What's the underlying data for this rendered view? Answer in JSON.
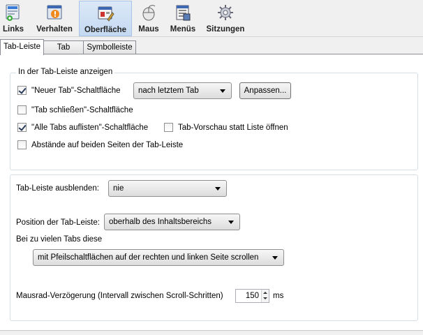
{
  "toolbar": {
    "items": [
      {
        "label": "Links",
        "icon": "links-icon"
      },
      {
        "label": "Verhalten",
        "icon": "behavior-icon"
      },
      {
        "label": "Oberfläche",
        "icon": "interface-icon",
        "selected": true
      },
      {
        "label": "Maus",
        "icon": "mouse-icon"
      },
      {
        "label": "Menüs",
        "icon": "menus-icon"
      },
      {
        "label": "Sitzungen",
        "icon": "sessions-icon"
      }
    ]
  },
  "tabs": [
    "Tab-Leiste",
    "Tab",
    "Symbolleiste"
  ],
  "active_tab": "Tab-Leiste",
  "group1": {
    "legend": "In der Tab-Leiste anzeigen",
    "new_tab_button": {
      "label": "\"Neuer Tab\"-Schaltfläche",
      "checked": true
    },
    "new_tab_combo": "nach letztem Tab",
    "customize_button": "Anpassen...",
    "close_tab_button": {
      "label": "\"Tab schließen\"-Schaltfläche",
      "checked": false
    },
    "list_all_tabs": {
      "label": "\"Alle Tabs auflisten\"-Schaltfläche",
      "checked": true
    },
    "tab_preview": {
      "label": "Tab-Vorschau statt Liste öffnen",
      "checked": false
    },
    "spacing": {
      "label": "Abstände auf beiden Seiten der Tab-Leiste",
      "checked": false
    }
  },
  "group2": {
    "hide_label": "Tab-Leiste ausblenden:",
    "hide_value": "nie",
    "position_label": "Position der Tab-Leiste:",
    "position_value": "oberhalb des Inhaltsbereichs",
    "overflow_label": "Bei zu vielen Tabs diese",
    "overflow_value": "mit Pfeilschaltflächen auf der rechten und linken Seite scrollen",
    "scroll_delay_label": "Mausrad-Verzögerung (Intervall zwischen Scroll-Schritten)",
    "scroll_delay_value": "150",
    "scroll_delay_unit": "ms"
  }
}
